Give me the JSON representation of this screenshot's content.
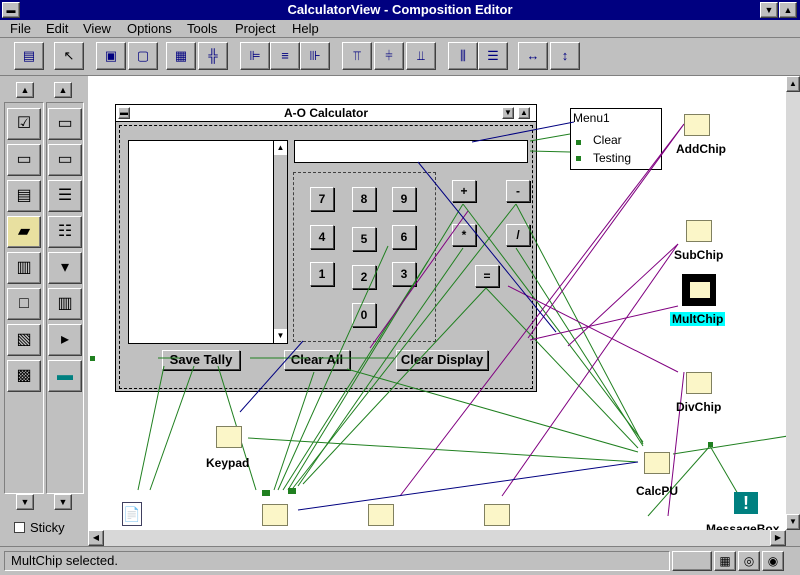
{
  "window": {
    "title": "CalculatorView - Composition Editor"
  },
  "menubar": {
    "items": [
      "File",
      "Edit",
      "View",
      "Options",
      "Tools",
      "Project",
      "Help"
    ]
  },
  "palette": {
    "sticky_label": "Sticky"
  },
  "calculator": {
    "title": "A-O Calculator",
    "digits": [
      "7",
      "8",
      "9",
      "4",
      "5",
      "6",
      "1",
      "2",
      "3",
      "0"
    ],
    "ops": [
      "+",
      "-",
      "*",
      "/",
      "="
    ],
    "buttons": {
      "save_tally": "Save Tally",
      "clear_all": "Clear All",
      "clear_display": "Clear Display"
    }
  },
  "menu1": {
    "title": "Menu1",
    "items": [
      "Clear",
      "Testing"
    ]
  },
  "parts": {
    "addchip": "AddChip",
    "subchip": "SubChip",
    "multchip": "MultChip",
    "divchip": "DivChip",
    "keypad": "Keypad",
    "calcpu": "CalcPU",
    "messagebox": "MessageBox"
  },
  "status": {
    "text": "MultChip selected."
  },
  "colors": {
    "title_bar": "#000080",
    "connection_green": "#208020",
    "connection_purple": "#800080",
    "connection_blue": "#000080",
    "selection_cyan": "#00ffff",
    "part_icon": "#fbf6c8"
  }
}
